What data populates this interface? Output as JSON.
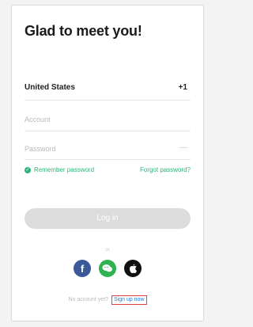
{
  "login": {
    "title": "Glad to meet you!",
    "country": {
      "name": "United States",
      "code": "+1"
    },
    "account_placeholder": "Account",
    "password_placeholder": "Password",
    "remember": "Remember password",
    "forgot": "Forgot password?",
    "login_button": "Log in",
    "or": "or",
    "social": [
      "facebook-icon",
      "wechat-icon",
      "apple-icon"
    ],
    "no_account": "No account yet?",
    "signup": "Sign up now"
  },
  "colors": {
    "accent": "#2fb37a",
    "login_button": "#dcdcdc",
    "signup_link": "#1e7bd8",
    "signup_outline": "#e0443a"
  }
}
